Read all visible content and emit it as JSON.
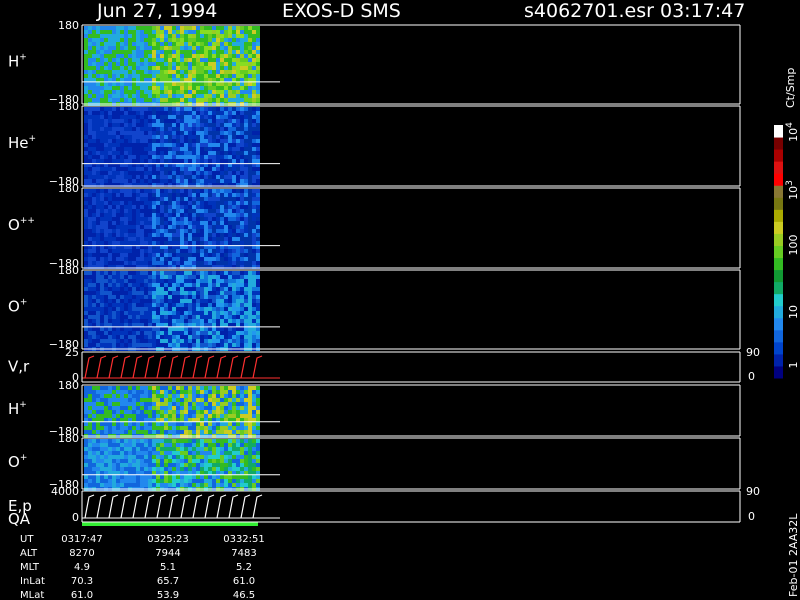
{
  "header": {
    "date": "Jun 27, 1994",
    "instrument": "EXOS-D SMS",
    "file": "s4062701.esr",
    "time": "03:17:47"
  },
  "colorbar": {
    "unit": "Ct/Smp",
    "ticks": [
      "1",
      "10",
      "100",
      "10",
      "10"
    ],
    "tick_exponents": [
      "",
      "",
      "",
      "3",
      "4"
    ],
    "colors": [
      "#000080",
      "#0022aa",
      "#0044cc",
      "#1166dd",
      "#2288ee",
      "#22aadd",
      "#22cccc",
      "#11aa66",
      "#119933",
      "#33bb22",
      "#66cc22",
      "#99cc22",
      "#cccc22",
      "#aaaa00",
      "#777711",
      "#887733",
      "#ff0000",
      "#dd1111",
      "#aa0000",
      "#770000",
      "#ffffff"
    ]
  },
  "panels": [
    {
      "label": "H",
      "sup": "+",
      "ymax": "180",
      "ymin": "−180"
    },
    {
      "label": "He",
      "sup": "+",
      "ymax": "180",
      "ymin": "−180"
    },
    {
      "label": "O",
      "sup": "++",
      "ymax": "180",
      "ymin": "−180"
    },
    {
      "label": "O",
      "sup": "+",
      "ymax": "180",
      "ymin": "−180"
    },
    {
      "label": "V,r",
      "sup": "",
      "ymax": "25",
      "ymin": "0",
      "right_top": "90",
      "right_bot": "0"
    },
    {
      "label": "H",
      "sup": "+",
      "ymax": "180",
      "ymin": "−180"
    },
    {
      "label": "O",
      "sup": "+",
      "ymax": "180",
      "ymin": "−180"
    },
    {
      "label": "E,p",
      "label2": "QA",
      "sup": "",
      "ymax": "4000",
      "ymin": "0",
      "right_top": "90",
      "right_bot": "0"
    }
  ],
  "ephemeris": {
    "rows": [
      "UT",
      "ALT",
      "MLT",
      "InLat",
      "MLat"
    ],
    "columns": [
      [
        "0317:47",
        "8270",
        "4.9",
        "70.3",
        "61.0"
      ],
      [
        "0325:23",
        "7944",
        "5.1",
        "65.7",
        "53.9"
      ],
      [
        "0332:51",
        "7483",
        "5.2",
        "61.0",
        "46.5"
      ]
    ]
  },
  "footer_label": "Feb-01 2AA32L",
  "chart_data": {
    "type": "heatmap",
    "title": "Jun 27, 1994   EXOS-D SMS   s4062701.esr  03:17:47",
    "x_ticks": [
      "0317:47",
      "0325:23",
      "0332:51"
    ],
    "y_range": [
      -180,
      180
    ],
    "series": [
      {
        "name": "H+",
        "dominant_colors": [
          "blue",
          "green",
          "yellow"
        ]
      },
      {
        "name": "He+",
        "dominant_colors": [
          "dark blue",
          "blue"
        ]
      },
      {
        "name": "O++",
        "dominant_colors": [
          "dark blue",
          "blue"
        ]
      },
      {
        "name": "O+",
        "dominant_colors": [
          "dark blue",
          "blue",
          "cyan"
        ]
      },
      {
        "name": "V,r",
        "range": [
          0,
          25
        ]
      },
      {
        "name": "H+",
        "dominant_colors": [
          "blue",
          "green",
          "yellow"
        ]
      },
      {
        "name": "O+",
        "dominant_colors": [
          "blue",
          "cyan",
          "green"
        ]
      },
      {
        "name": "E,p",
        "range": [
          0,
          4000
        ]
      }
    ],
    "colorbar_scale": "log",
    "colorbar_range": [
      1,
      10000
    ],
    "colorbar_unit": "Ct/Smp"
  }
}
